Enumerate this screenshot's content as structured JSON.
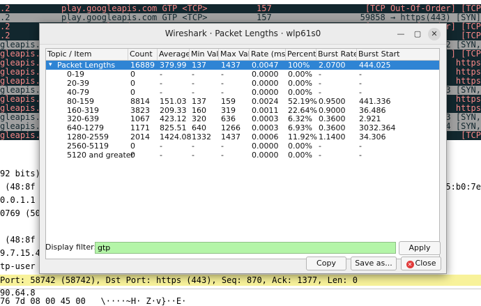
{
  "background": {
    "packet_rows": [
      {
        "style": "red",
        "left": ".2",
        "mid": "play.googleapis.com GTP <TCP>",
        "num": "157",
        "right": "[TCP Out-Of-Order] [TCP"
      },
      {
        "style": "grey",
        "left": ".2",
        "mid": "play.googleapis.com GTP <TCP>",
        "num": "157",
        "right": "59858 → https(443) [SYN]"
      },
      {
        "style": "red",
        "left": ".2",
        "mid": "play.googleapis.com GTP <TCP>",
        "num": "157",
        "right": "[TCP Out-Of-Order] [TCP"
      },
      {
        "style": "red",
        "left": ".2",
        "mid": "",
        "num": "",
        "right": "[TCP"
      },
      {
        "style": "grey",
        "left": "gleapis.",
        "mid": "",
        "num": "",
        "right": "2 [SYN,"
      },
      {
        "style": "red",
        "left": "gleapis.",
        "mid": "",
        "num": "",
        "right": "] [TCP"
      },
      {
        "style": "red",
        "left": "gleapis.",
        "mid": "",
        "num": "",
        "right": "https"
      },
      {
        "style": "red",
        "left": "gleapis.",
        "mid": "",
        "num": "",
        "right": "https"
      },
      {
        "style": "red",
        "left": "gleapis.",
        "mid": "",
        "num": "",
        "right": "https"
      },
      {
        "style": "grey",
        "left": "gleapis.",
        "mid": "",
        "num": "",
        "right": "3 [SYN,"
      },
      {
        "style": "red",
        "left": "gleapis.",
        "mid": "",
        "num": "",
        "right": "https"
      },
      {
        "style": "red",
        "left": "gleapis.",
        "mid": "",
        "num": "",
        "right": "https"
      },
      {
        "style": "grey",
        "left": "gleapis.",
        "mid": "",
        "num": "",
        "right": "3 [SYN,"
      },
      {
        "style": "grey",
        "left": "gleapis.",
        "mid": "",
        "num": "",
        "right": "4 [SYN,"
      },
      {
        "style": "red",
        "left": "gleapis.",
        "mid": "",
        "num": "",
        "right": "[TCP"
      }
    ],
    "detail_lines": [
      "92 bits)",
      " (48:8f",
      "0.0.1.1",
      "0769 (50",
      "",
      " (48:8f",
      "9.7.15.4",
      "tp-user",
      "",
      "90.64.8"
    ],
    "detail_right": "5:b0:7e",
    "status_line": "Port: 58742 (58742), Dst Port: https (443), Seq: 870, Ack: 1377, Len: 0",
    "hex_line": "76 7d 08 00 45 00   \\····~H· Z·v}··E·"
  },
  "dialog": {
    "title": "Wireshark · Packet Lengths · wlp61s0",
    "columns": [
      "Topic / Item",
      "Count",
      "Average",
      "Min Val",
      "Max Val",
      "Rate (ms)",
      "Percent",
      "Burst Rate",
      "Burst Start"
    ],
    "rows": [
      {
        "item": "Packet Lengths",
        "count": "16889",
        "avg": "379.99",
        "min": "137",
        "max": "1437",
        "rate": "0.0047",
        "pct": "100%",
        "burst_rate": "2.0700",
        "burst_start": "444.025",
        "selected": true,
        "expander": "▾"
      },
      {
        "item": "0-19",
        "count": "0",
        "avg": "-",
        "min": "-",
        "max": "-",
        "rate": "0.0000",
        "pct": "0.00%",
        "burst_rate": "-",
        "burst_start": "-"
      },
      {
        "item": "20-39",
        "count": "0",
        "avg": "-",
        "min": "-",
        "max": "-",
        "rate": "0.0000",
        "pct": "0.00%",
        "burst_rate": "-",
        "burst_start": "-"
      },
      {
        "item": "40-79",
        "count": "0",
        "avg": "-",
        "min": "-",
        "max": "-",
        "rate": "0.0000",
        "pct": "0.00%",
        "burst_rate": "-",
        "burst_start": "-"
      },
      {
        "item": "80-159",
        "count": "8814",
        "avg": "151.03",
        "min": "137",
        "max": "159",
        "rate": "0.0024",
        "pct": "52.19%",
        "burst_rate": "0.9500",
        "burst_start": "441.336"
      },
      {
        "item": "160-319",
        "count": "3823",
        "avg": "209.33",
        "min": "160",
        "max": "319",
        "rate": "0.0011",
        "pct": "22.64%",
        "burst_rate": "0.9000",
        "burst_start": "36.486"
      },
      {
        "item": "320-639",
        "count": "1067",
        "avg": "423.12",
        "min": "320",
        "max": "636",
        "rate": "0.0003",
        "pct": "6.32%",
        "burst_rate": "0.3600",
        "burst_start": "2.921"
      },
      {
        "item": "640-1279",
        "count": "1171",
        "avg": "825.51",
        "min": "640",
        "max": "1266",
        "rate": "0.0003",
        "pct": "6.93%",
        "burst_rate": "0.3600",
        "burst_start": "3032.364"
      },
      {
        "item": "1280-2559",
        "count": "2014",
        "avg": "1424.08",
        "min": "1332",
        "max": "1437",
        "rate": "0.0006",
        "pct": "11.92%",
        "burst_rate": "1.1400",
        "burst_start": "34.306"
      },
      {
        "item": "2560-5119",
        "count": "0",
        "avg": "-",
        "min": "-",
        "max": "-",
        "rate": "0.0000",
        "pct": "0.00%",
        "burst_rate": "-",
        "burst_start": "-"
      },
      {
        "item": "5120 and greater",
        "count": "0",
        "avg": "-",
        "min": "-",
        "max": "-",
        "rate": "0.0000",
        "pct": "0.00%",
        "burst_rate": "-",
        "burst_start": "-"
      }
    ],
    "filter": {
      "label": "Display filter:",
      "value": "gtp"
    },
    "buttons": {
      "apply": "Apply",
      "copy": "Copy",
      "save_as": "Save as...",
      "close": "Close",
      "close_glyph": "✕"
    },
    "window_controls": {
      "minimize": "—",
      "maximize": "▢",
      "close": "✕"
    },
    "colors": {
      "selection": "#2f84d4",
      "filter_valid": "#b4f5a8",
      "row_red_bg": "#12272e",
      "row_red_fg": "#f78787",
      "row_grey": "#a0a0a0",
      "status_yellow": "#f8f29a"
    }
  }
}
